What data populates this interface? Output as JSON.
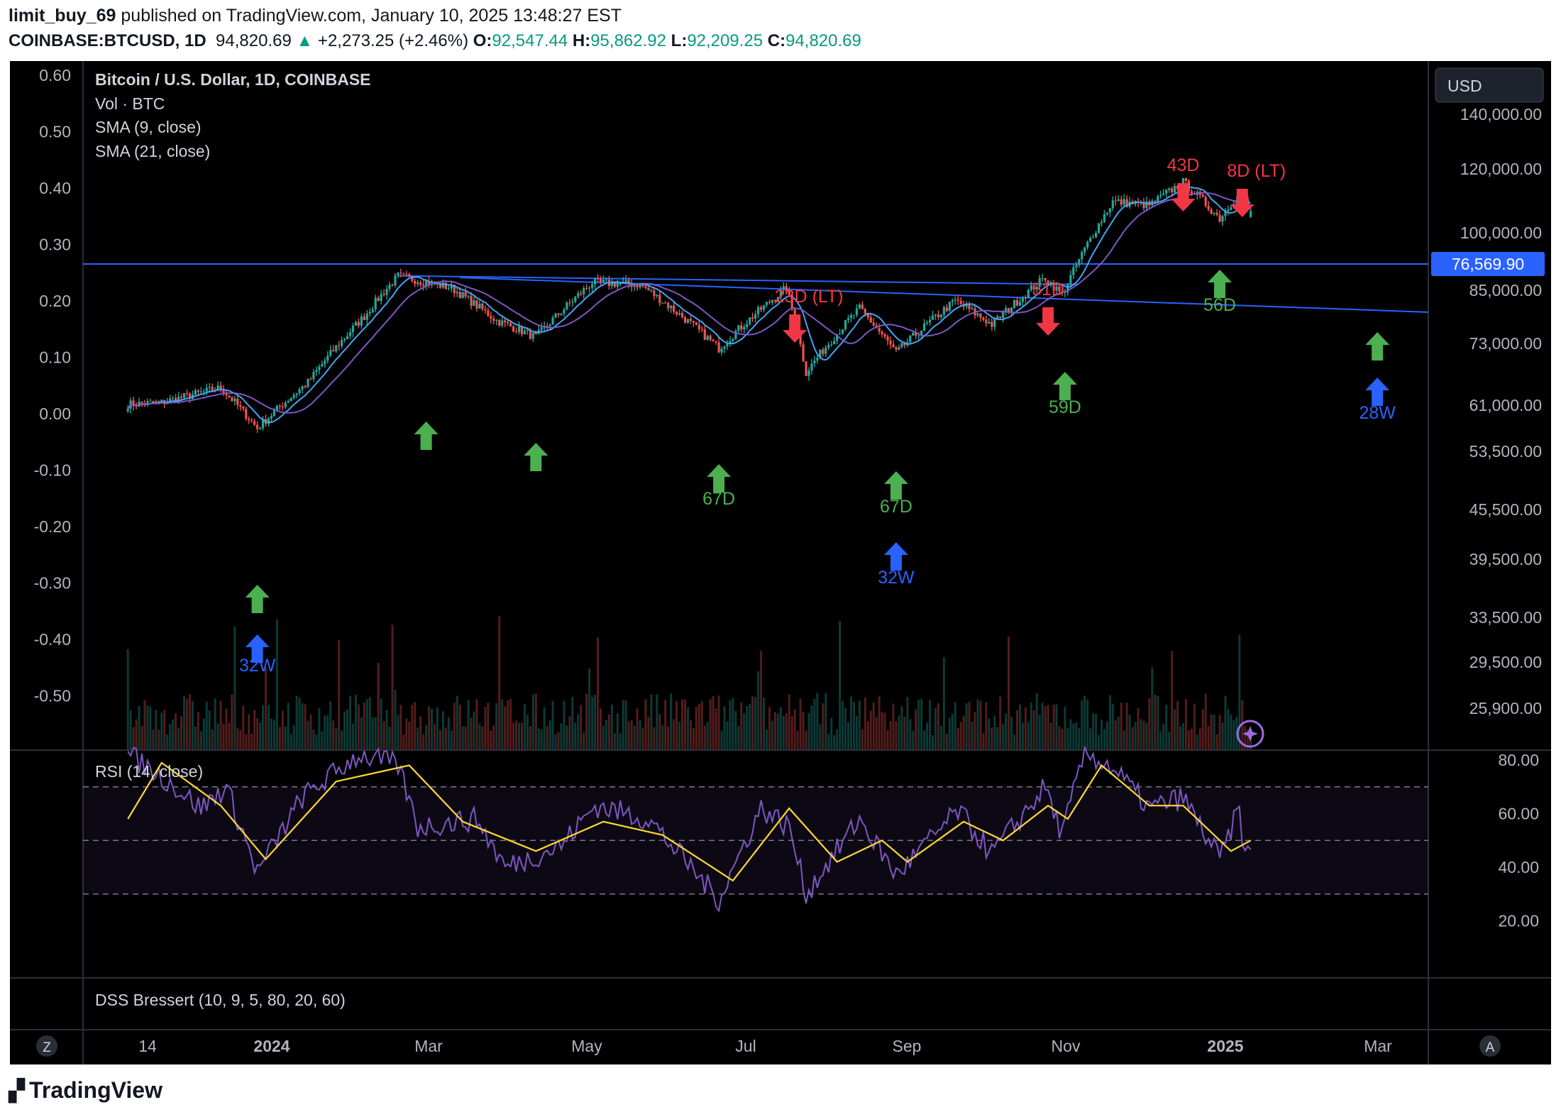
{
  "header": {
    "publisher": "limit_buy_69",
    "published_text": " published on TradingView.com, January 10, 2025 13:48:27 EST",
    "symbol": "COINBASE:BTCUSD, 1D",
    "last": "94,820.69",
    "change": "+2,273.25 (+2.46%)",
    "o_label": "O:",
    "o": "92,547.44",
    "h_label": "H:",
    "h": "95,862.92",
    "l_label": "L:",
    "l": "92,209.25",
    "c_label": "C:",
    "c": "94,820.69"
  },
  "legend": {
    "title": "Bitcoin / U.S. Dollar, 1D, COINBASE",
    "vol": "Vol · BTC",
    "sma9": "SMA (9, close)",
    "sma21": "SMA (21, close)"
  },
  "rsi_panel": {
    "label": "RSI (14, close)"
  },
  "dss_panel": {
    "label": "DSS Bressert (10, 9, 5, 80, 20, 60)"
  },
  "currency_button": "USD",
  "price_tag": "76,569.90",
  "footer_brand": "TradingView",
  "scale_buttons": {
    "left": "Z",
    "right": "A"
  },
  "colors": {
    "background": "#000000",
    "up": "#26a69a",
    "down": "#ef5350",
    "sma9": "#42a5f5",
    "sma21": "#7e57c2",
    "rsi": "#7e57c2",
    "rsi_ma": "#fdd835",
    "trendline": "#2962ff",
    "green_arrow": "#4caf50",
    "red_arrow": "#f23645",
    "blue_arrow": "#2962ff"
  },
  "chart_data": [
    {
      "type": "candlestick",
      "title": "Bitcoin / U.S. Dollar, 1D, COINBASE",
      "right_axis_ticks": [
        "140,000.00",
        "120,000.00",
        "100,000.00",
        "85,000.00",
        "73,000.00",
        "61,000.00",
        "53,500.00",
        "45,500.00",
        "39,500.00",
        "33,500.00",
        "29,500.00",
        "25,900.00"
      ],
      "left_axis_ticks": [
        "0.60",
        "0.50",
        "0.40",
        "0.30",
        "0.20",
        "0.10",
        "0.00",
        "-0.10",
        "-0.20",
        "-0.30",
        "-0.40",
        "-0.50"
      ],
      "x_ticks": [
        "14",
        "2024",
        "Mar",
        "May",
        "Jul",
        "Sep",
        "Nov",
        "2025",
        "Mar"
      ],
      "ylim": [
        23500,
        150000
      ],
      "log_scale": true,
      "price_path": [
        {
          "date": "2023-12-08",
          "close": 43500
        },
        {
          "date": "2023-12-20",
          "close": 43800
        },
        {
          "date": "2024-01-10",
          "close": 46500
        },
        {
          "date": "2024-01-23",
          "close": 39500
        },
        {
          "date": "2024-02-10",
          "close": 47500
        },
        {
          "date": "2024-03-01",
          "close": 62000
        },
        {
          "date": "2024-03-13",
          "close": 73000
        },
        {
          "date": "2024-04-01",
          "close": 69500
        },
        {
          "date": "2024-04-17",
          "close": 61000
        },
        {
          "date": "2024-05-01",
          "close": 57000
        },
        {
          "date": "2024-05-21",
          "close": 71000
        },
        {
          "date": "2024-06-07",
          "close": 70500
        },
        {
          "date": "2024-07-05",
          "close": 54500
        },
        {
          "date": "2024-07-29",
          "close": 69500
        },
        {
          "date": "2024-08-05",
          "close": 49500
        },
        {
          "date": "2024-08-24",
          "close": 64000
        },
        {
          "date": "2024-09-06",
          "close": 53500
        },
        {
          "date": "2024-09-27",
          "close": 66000
        },
        {
          "date": "2024-10-10",
          "close": 60000
        },
        {
          "date": "2024-10-29",
          "close": 72500
        },
        {
          "date": "2024-11-04",
          "close": 67500
        },
        {
          "date": "2024-11-22",
          "close": 98500
        },
        {
          "date": "2024-12-05",
          "close": 97000
        },
        {
          "date": "2024-12-17",
          "close": 106500
        },
        {
          "date": "2024-12-30",
          "close": 92000
        },
        {
          "date": "2025-01-06",
          "close": 102000
        },
        {
          "date": "2025-01-10",
          "close": 94820.69
        }
      ],
      "horizontal_line": 76569.9,
      "trendlines": [
        {
          "from": {
            "date": "2024-03-13",
            "price": 73000
          },
          "to": {
            "date": "2024-11-10",
            "price": 70500
          }
        },
        {
          "from": {
            "date": "2024-04-04",
            "price": 72500
          },
          "to": {
            "date": "2025-04-25",
            "price": 62000
          }
        }
      ],
      "annotations": [
        {
          "text": "32W",
          "color": "blue",
          "dir": "up",
          "date": "2024-01-23"
        },
        {
          "text": "",
          "color": "green",
          "dir": "up",
          "date": "2024-01-23"
        },
        {
          "text": "",
          "color": "green",
          "dir": "up",
          "date": "2024-03-23"
        },
        {
          "text": "",
          "color": "green",
          "dir": "up",
          "date": "2024-05-01"
        },
        {
          "text": "67D",
          "color": "green",
          "dir": "up",
          "date": "2024-07-05"
        },
        {
          "text": "23D (LT)",
          "color": "red",
          "dir": "down",
          "date": "2024-08-01"
        },
        {
          "text": "67D",
          "color": "green",
          "dir": "up",
          "date": "2024-09-06"
        },
        {
          "text": "32W",
          "color": "blue",
          "dir": "up",
          "date": "2024-09-06"
        },
        {
          "text": "51D",
          "color": "red",
          "dir": "down",
          "date": "2024-10-30"
        },
        {
          "text": "59D",
          "color": "green",
          "dir": "up",
          "date": "2024-11-05"
        },
        {
          "text": "43D",
          "color": "red",
          "dir": "down",
          "date": "2024-12-17"
        },
        {
          "text": "56D",
          "color": "green",
          "dir": "up",
          "date": "2024-12-30"
        },
        {
          "text": "8D (LT)",
          "color": "red",
          "dir": "down",
          "date": "2025-01-07"
        },
        {
          "text": "",
          "color": "green",
          "dir": "up",
          "date": "2025-02-24"
        },
        {
          "text": "28W",
          "color": "blue",
          "dir": "up",
          "date": "2025-02-24"
        }
      ]
    },
    {
      "type": "line",
      "title": "RSI (14, close)",
      "y_ticks": [
        "80.00",
        "60.00",
        "40.00",
        "20.00"
      ],
      "ylim": [
        18,
        85
      ],
      "bands": [
        70,
        50,
        30
      ],
      "series": [
        {
          "name": "RSI (14, close)",
          "points": [
            {
              "date": "2023-12-08",
              "value": 82
            },
            {
              "date": "2023-12-20",
              "value": 74
            },
            {
              "date": "2024-01-03",
              "value": 62
            },
            {
              "date": "2024-01-12",
              "value": 70
            },
            {
              "date": "2024-01-23",
              "value": 38
            },
            {
              "date": "2024-02-08",
              "value": 66
            },
            {
              "date": "2024-02-28",
              "value": 82
            },
            {
              "date": "2024-03-13",
              "value": 78
            },
            {
              "date": "2024-03-20",
              "value": 55
            },
            {
              "date": "2024-04-10",
              "value": 58
            },
            {
              "date": "2024-04-20",
              "value": 40
            },
            {
              "date": "2024-05-10",
              "value": 48
            },
            {
              "date": "2024-05-22",
              "value": 63
            },
            {
              "date": "2024-06-10",
              "value": 58
            },
            {
              "date": "2024-07-05",
              "value": 28
            },
            {
              "date": "2024-07-20",
              "value": 62
            },
            {
              "date": "2024-07-30",
              "value": 55
            },
            {
              "date": "2024-08-05",
              "value": 30
            },
            {
              "date": "2024-08-24",
              "value": 58
            },
            {
              "date": "2024-09-06",
              "value": 37
            },
            {
              "date": "2024-09-28",
              "value": 61
            },
            {
              "date": "2024-10-10",
              "value": 45
            },
            {
              "date": "2024-10-29",
              "value": 70
            },
            {
              "date": "2024-11-04",
              "value": 52
            },
            {
              "date": "2024-11-12",
              "value": 83
            },
            {
              "date": "2024-11-22",
              "value": 77
            },
            {
              "date": "2024-12-05",
              "value": 62
            },
            {
              "date": "2024-12-17",
              "value": 66
            },
            {
              "date": "2024-12-30",
              "value": 43
            },
            {
              "date": "2025-01-06",
              "value": 62
            },
            {
              "date": "2025-01-08",
              "value": 43
            },
            {
              "date": "2025-01-10",
              "value": 48
            }
          ]
        },
        {
          "name": "RSI MA",
          "points": [
            {
              "date": "2023-12-08",
              "value": 58
            },
            {
              "date": "2023-12-20",
              "value": 79
            },
            {
              "date": "2024-01-10",
              "value": 63
            },
            {
              "date": "2024-01-26",
              "value": 43
            },
            {
              "date": "2024-02-20",
              "value": 72
            },
            {
              "date": "2024-03-17",
              "value": 78
            },
            {
              "date": "2024-04-05",
              "value": 57
            },
            {
              "date": "2024-05-01",
              "value": 46
            },
            {
              "date": "2024-05-25",
              "value": 57
            },
            {
              "date": "2024-06-15",
              "value": 52
            },
            {
              "date": "2024-07-10",
              "value": 35
            },
            {
              "date": "2024-07-30",
              "value": 62
            },
            {
              "date": "2024-08-16",
              "value": 42
            },
            {
              "date": "2024-09-01",
              "value": 50
            },
            {
              "date": "2024-09-10",
              "value": 42
            },
            {
              "date": "2024-09-30",
              "value": 57
            },
            {
              "date": "2024-10-14",
              "value": 50
            },
            {
              "date": "2024-10-30",
              "value": 63
            },
            {
              "date": "2024-11-06",
              "value": 58
            },
            {
              "date": "2024-11-18",
              "value": 78
            },
            {
              "date": "2024-12-05",
              "value": 63
            },
            {
              "date": "2024-12-17",
              "value": 63
            },
            {
              "date": "2025-01-03",
              "value": 46
            },
            {
              "date": "2025-01-10",
              "value": 50
            }
          ]
        }
      ]
    }
  ]
}
